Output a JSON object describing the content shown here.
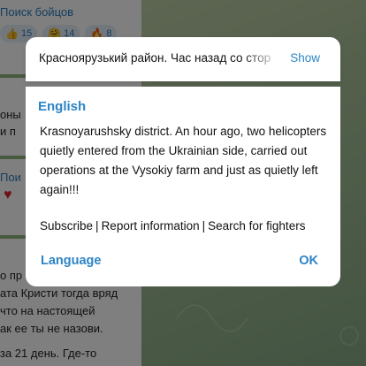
{
  "background": {
    "search_link": "Поиск бойцов",
    "reactions": [
      {
        "icon": "thumbs-up",
        "emoji": "👍",
        "count": "15"
      },
      {
        "icon": "hug",
        "emoji": "🤗",
        "count": "14"
      },
      {
        "icon": "fire",
        "emoji": "🔥",
        "count": "8"
      }
    ],
    "snippet_1": "оны",
    "snippet_2": "и п",
    "snippet_3": "Пои",
    "snippet_4": "о пр",
    "snippet_5": "ата Кристи тогда вряд",
    "snippet_6": "что на настоящей",
    "snippet_7": "ак ее ты не назови.",
    "snippet_8": "за 21 день. Где-то"
  },
  "banner": {
    "original_text": "Красноярузький район. Час назад со стороны",
    "show_label": "Show"
  },
  "dialog": {
    "language_title": "English",
    "translation": "Krasnoyarushsky district. An hour ago, two helicopters quietly entered from the Ukrainian side, carried out operations at the Vysokiy farm and just as quietly left again!!!",
    "links": {
      "subscribe": "Subscribe",
      "report": "Report information",
      "search": "Search for fighters",
      "separator": "|"
    },
    "language_button": "Language",
    "ok_button": "OK"
  },
  "colors": {
    "accent": "#2d84c6",
    "overlay": "#000000"
  }
}
